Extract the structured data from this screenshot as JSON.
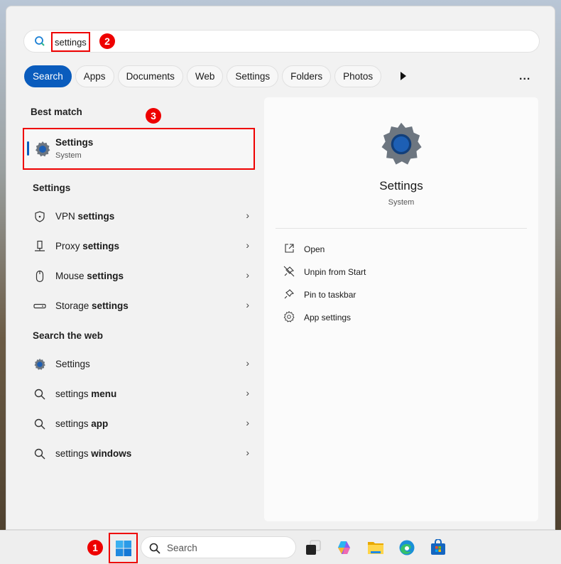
{
  "search": {
    "value": "settings",
    "badge": "2"
  },
  "filters": [
    "Search",
    "Apps",
    "Documents",
    "Web",
    "Settings",
    "Folders",
    "Photos"
  ],
  "more_label": "...",
  "best_match": {
    "heading": "Best match",
    "badge": "3",
    "title": "Settings",
    "subtitle": "System"
  },
  "settings_section": {
    "heading": "Settings",
    "items": [
      {
        "prefix": "VPN ",
        "bold": "settings",
        "icon": "shield-icon"
      },
      {
        "prefix": "Proxy ",
        "bold": "settings",
        "icon": "proxy-icon"
      },
      {
        "prefix": "Mouse ",
        "bold": "settings",
        "icon": "mouse-icon"
      },
      {
        "prefix": "Storage ",
        "bold": "settings",
        "icon": "storage-icon"
      }
    ]
  },
  "web_section": {
    "heading": "Search the web",
    "items": [
      {
        "prefix": "Settings",
        "bold": ""
      },
      {
        "prefix": "settings ",
        "bold": "menu"
      },
      {
        "prefix": "settings ",
        "bold": "app"
      },
      {
        "prefix": "settings ",
        "bold": "windows"
      }
    ]
  },
  "detail": {
    "title": "Settings",
    "subtitle": "System",
    "actions": [
      "Open",
      "Unpin from Start",
      "Pin to taskbar",
      "App settings"
    ]
  },
  "taskbar": {
    "badge": "1",
    "search_placeholder": "Search"
  }
}
